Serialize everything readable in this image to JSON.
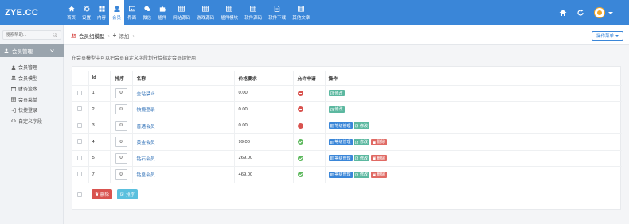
{
  "brand": "ZYE.CC",
  "nav": [
    {
      "label": "首页",
      "icon": "home-icon"
    },
    {
      "label": "设置",
      "icon": "gear-icon"
    },
    {
      "label": "内容",
      "icon": "grid-icon"
    },
    {
      "label": "会员",
      "icon": "user-icon",
      "active": true
    },
    {
      "label": "界面",
      "icon": "image-icon"
    },
    {
      "label": "微信",
      "icon": "wechat-icon"
    },
    {
      "label": "插件",
      "icon": "puzzle-icon"
    },
    {
      "label": "网站源码",
      "icon": "table-icon"
    },
    {
      "label": "游戏源码",
      "icon": "table-icon"
    },
    {
      "label": "插件模块",
      "icon": "table-icon"
    },
    {
      "label": "软件源码",
      "icon": "table-icon"
    },
    {
      "label": "软件下载",
      "icon": "file-icon"
    },
    {
      "label": "其他文章",
      "icon": "table-icon"
    }
  ],
  "sidebar": {
    "search_placeholder": "搜索帮助...",
    "section_title": "会员管理",
    "items": [
      {
        "label": "会员管理",
        "icon": "user-icon"
      },
      {
        "label": "会员模型",
        "icon": "users-icon"
      },
      {
        "label": "财务流水",
        "icon": "calendar-icon"
      },
      {
        "label": "会员菜单",
        "icon": "table-icon"
      },
      {
        "label": "快捷登录",
        "icon": "login-icon"
      },
      {
        "label": "自定义字段",
        "icon": "code-icon"
      }
    ]
  },
  "breadcrumb": {
    "current": "会员组模型",
    "sep": "›",
    "add": "添加"
  },
  "op_menu": "操作菜单",
  "hint": "在会员模型中可以把会员自定义字段划分给指定会员组使用",
  "table": {
    "headers": {
      "id": "Id",
      "sort": "排序",
      "name": "名称",
      "price": "价格要求",
      "allow": "允许申请",
      "ops": "操作"
    },
    "rows": [
      {
        "id": "1",
        "sort": "0",
        "name": "全站禁止",
        "price": "0.00",
        "allow": false,
        "ops": [
          "edit"
        ]
      },
      {
        "id": "2",
        "sort": "0",
        "name": "快捷登录",
        "price": "0.00",
        "allow": false,
        "ops": [
          "edit"
        ]
      },
      {
        "id": "3",
        "sort": "0",
        "name": "普通会员",
        "price": "0.00",
        "allow": false,
        "ops": [
          "level",
          "edit"
        ]
      },
      {
        "id": "4",
        "sort": "0",
        "name": "黄金会员",
        "price": "99.00",
        "allow": true,
        "ops": [
          "level",
          "edit",
          "del"
        ]
      },
      {
        "id": "5",
        "sort": "0",
        "name": "钻石会员",
        "price": "269.00",
        "allow": true,
        "ops": [
          "level",
          "edit",
          "del"
        ]
      },
      {
        "id": "7",
        "sort": "0",
        "name": "钻皇会员",
        "price": "469.00",
        "allow": true,
        "ops": [
          "level",
          "edit",
          "del"
        ]
      }
    ]
  },
  "buttons": {
    "level": "等级管理",
    "edit": "修改",
    "del": "删除",
    "bulk_delete": "删除",
    "bulk_sort": "排序"
  },
  "colors": {
    "primary": "#3a86d8",
    "edit": "#5cb8a0",
    "danger": "#e06a64",
    "info": "#5bc0de",
    "ok": "#5cb85c"
  }
}
